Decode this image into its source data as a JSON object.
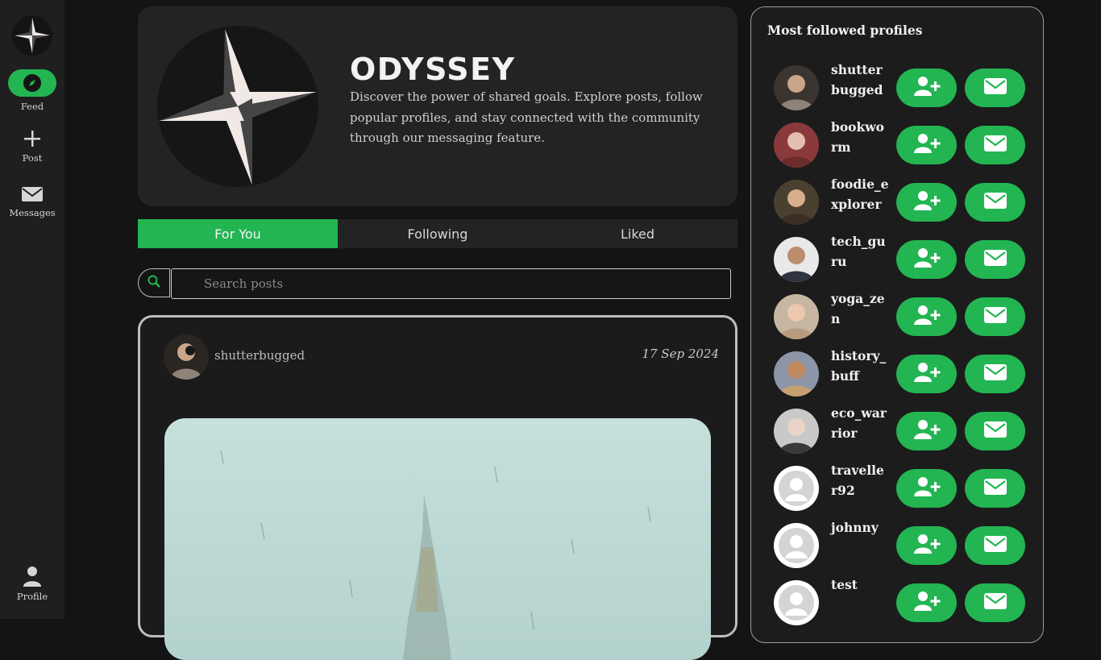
{
  "sidebar": {
    "items": [
      {
        "label": "Feed",
        "icon": "compass-icon"
      },
      {
        "label": "Post",
        "icon": "plus-icon"
      },
      {
        "label": "Messages",
        "icon": "envelope-icon"
      },
      {
        "label": "Profile",
        "icon": "user-icon"
      }
    ]
  },
  "header": {
    "title": "ODYSSEY",
    "description": "Discover the power of shared goals. Explore posts, follow popular profiles, and stay connected with the community through our messaging feature."
  },
  "tabs": [
    {
      "label": "For You",
      "active": true
    },
    {
      "label": "Following",
      "active": false
    },
    {
      "label": "Liked",
      "active": false
    }
  ],
  "search": {
    "placeholder": "Search posts"
  },
  "post": {
    "username": "shutterbugged",
    "date": "17 Sep 2024"
  },
  "right_panel": {
    "title": "Most followed profiles",
    "profiles": [
      {
        "name": "shutterbugged"
      },
      {
        "name": "bookworm"
      },
      {
        "name": "foodie_explorer"
      },
      {
        "name": "tech_guru"
      },
      {
        "name": "yoga_zen"
      },
      {
        "name": "history_buff"
      },
      {
        "name": "eco_warrior"
      },
      {
        "name": "traveller92"
      },
      {
        "name": "johnny"
      },
      {
        "name": "test"
      }
    ]
  },
  "colors": {
    "accent": "#22b552",
    "background": "#141414",
    "card": "#232323"
  }
}
